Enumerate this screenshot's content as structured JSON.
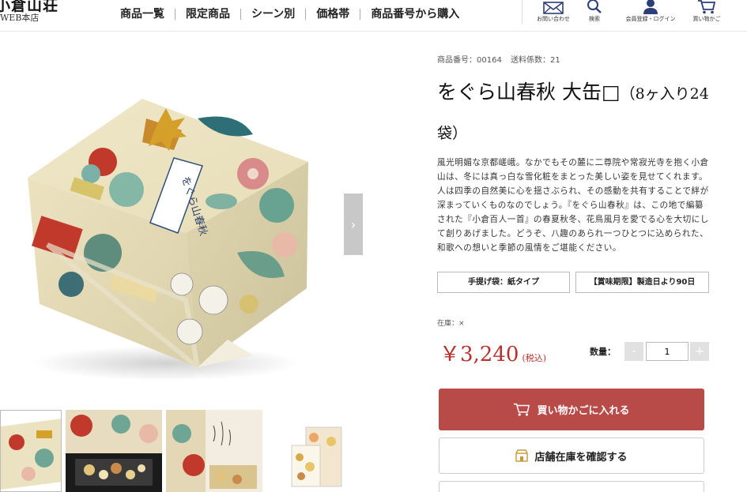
{
  "header": {
    "logo_mark": "小倉山荘",
    "logo_sub": "WEB本店",
    "nav": [
      "商品一覧",
      "限定商品",
      "シーン別",
      "価格帯",
      "商品番号から購入"
    ],
    "icons": [
      {
        "name": "mail-icon",
        "label": "お問い合わせ"
      },
      {
        "name": "search-icon",
        "label": "検索"
      },
      {
        "name": "user-icon",
        "label": "会員登録・ログイン"
      },
      {
        "name": "cart-icon",
        "label": "買い物かご"
      }
    ]
  },
  "product": {
    "meta_code": "商品番号：00164",
    "meta_shipping": "送料係数：21",
    "title": "をぐら山春秋 大缶□",
    "title_sub": "（8ヶ入り24袋）",
    "description": "風光明媚な京都嵯峨。なかでもその麓に二尊院や常寂光寺を抱く小倉山は、冬には真っ白な雪化粧をまとった美しい姿を見せてくれます。人は四季の自然美に心を揺さぶられ、その感動を共有することで絆が深まっていくものなのでしょう。『をぐら山春秋』は、この地で編纂された『小倉百人一首』の春夏秋冬、花鳥風月を愛でる心を大切にして創りあげました。どうぞ、八趣のあられ一つひとつに込められた、和歌への想いと季節の風情をご堪能ください。",
    "tags": [
      "手提げ袋：紙タイプ",
      "【賞味期限】製造日より90日"
    ],
    "stock": "在庫：×",
    "price": "￥3,240",
    "tax_note": "(税込)",
    "qty_label": "数量：",
    "qty_value": "1",
    "qty_minus": "-",
    "qty_plus": "+",
    "box_label": "をぐら山春秋"
  },
  "actions": {
    "cart_button": "買い物かごに入れる",
    "store_button": "店舗在庫を確認する"
  },
  "colors": {
    "accent": "#b84a48",
    "price": "#b8312f"
  }
}
